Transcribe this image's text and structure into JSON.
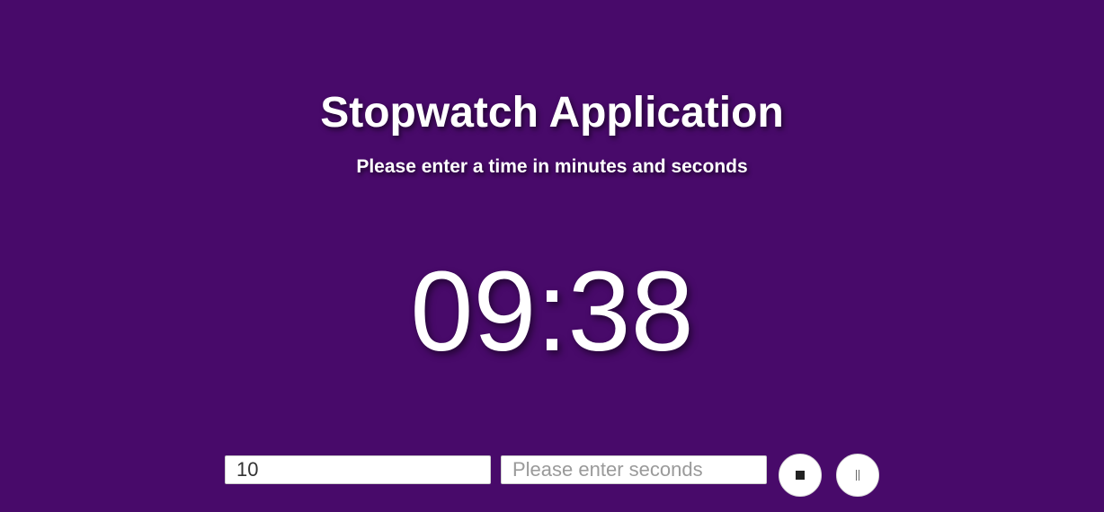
{
  "app": {
    "title": "Stopwatch Application",
    "subtitle": "Please enter a time in minutes and seconds"
  },
  "timer": {
    "display": "09:38"
  },
  "controls": {
    "minutes_value": "10",
    "minutes_placeholder": "",
    "seconds_value": "",
    "seconds_placeholder": "Please enter seconds",
    "stop_icon": "stop-icon",
    "pause_icon": "pause-icon"
  },
  "colors": {
    "background": "#480a6a",
    "text": "#ffffff"
  }
}
